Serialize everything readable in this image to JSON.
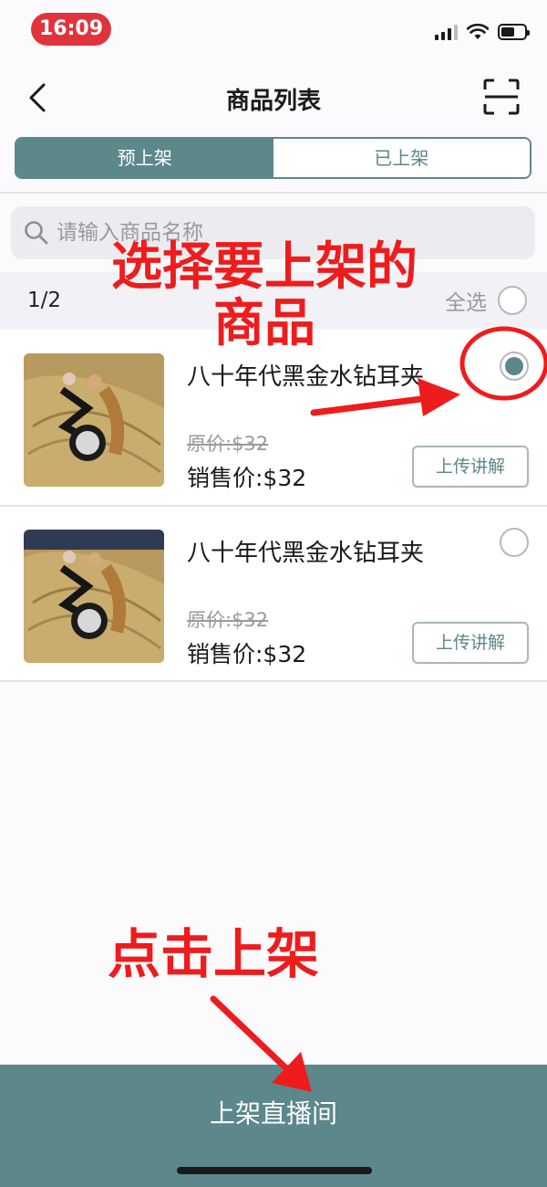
{
  "status_bar": {
    "time": "16:09"
  },
  "nav": {
    "title": "商品列表"
  },
  "tabs": [
    {
      "label": "预上架",
      "active": true
    },
    {
      "label": "已上架",
      "active": false
    }
  ],
  "search": {
    "placeholder": "请输入商品名称",
    "value": ""
  },
  "list_header": {
    "count": "1/2",
    "select_all_label": "全选"
  },
  "products": [
    {
      "name": "八十年代黑金水钻耳夹",
      "original_price": "原价:$32",
      "sale_price": "销售价:$32",
      "button_label": "上传讲解",
      "selected": true
    },
    {
      "name": "八十年代黑金水钻耳夹",
      "original_price": "原价:$32",
      "sale_price": "销售价:$32",
      "button_label": "上传讲解",
      "selected": false
    }
  ],
  "bottom": {
    "button_label": "上架直播间"
  },
  "annotations": {
    "select_hint": "选择要上架的商品",
    "click_hint": "点击上架"
  },
  "colors": {
    "accent": "#5c878b",
    "annotation": "#ee1c1c",
    "time_pill": "#e0343c"
  }
}
